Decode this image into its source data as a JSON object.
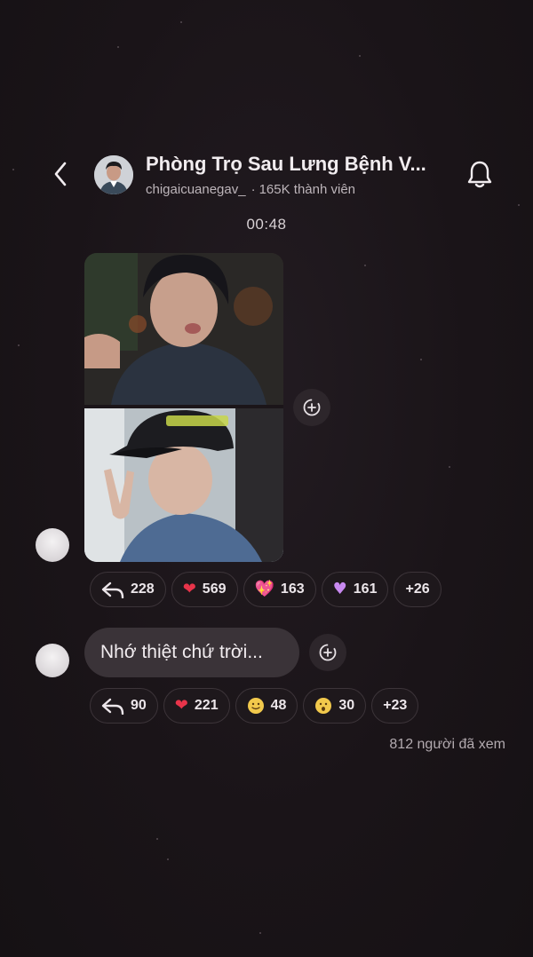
{
  "header": {
    "back_icon": "chevron-left-icon",
    "group_title": "Phòng Trọ Sau Lưng Bệnh V...",
    "owner_handle": "chigaicuanegav_",
    "member_count": "165K thành viên",
    "bell_icon": "bell-icon"
  },
  "timestamp": "00:48",
  "messages": [
    {
      "type": "photos",
      "photo_count": 2,
      "reactions": [
        {
          "icon": "reply-icon",
          "count": "228"
        },
        {
          "icon": "red-heart-icon",
          "count": "569"
        },
        {
          "icon": "sparkling-heart-icon",
          "count": "163"
        },
        {
          "icon": "purple-heart-icon",
          "count": "161"
        },
        {
          "icon": "",
          "count": "+26"
        }
      ]
    },
    {
      "type": "text",
      "text": "Nhớ thiệt chứ trời...",
      "reactions": [
        {
          "icon": "reply-icon",
          "count": "90"
        },
        {
          "icon": "red-heart-icon",
          "count": "221"
        },
        {
          "icon": "smiling-face-icon",
          "count": "48"
        },
        {
          "icon": "surprised-face-icon",
          "count": "30"
        },
        {
          "icon": "",
          "count": "+23"
        }
      ]
    }
  ],
  "seen_label": "812 người đã xem",
  "colors": {
    "background": "#1b1519",
    "bubble": "#3a3338",
    "chip_border": "#3c3439",
    "heart_red": "#e8344a"
  }
}
